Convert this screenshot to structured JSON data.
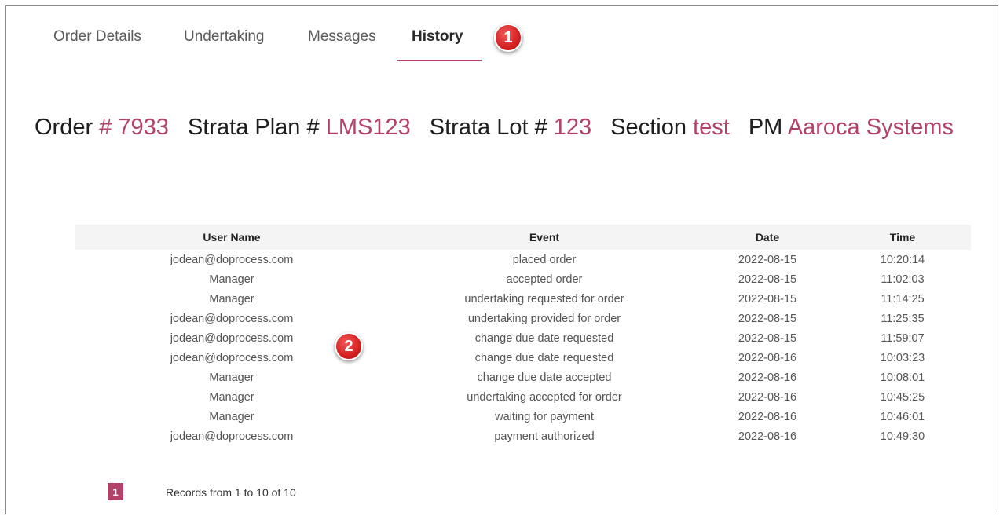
{
  "tabs": [
    {
      "label": "Order Details"
    },
    {
      "label": "Undertaking"
    },
    {
      "label": "Messages"
    },
    {
      "label": "History"
    }
  ],
  "active_tab": "History",
  "markers": [
    "1",
    "2"
  ],
  "order_info": {
    "order_label": "Order",
    "order_value": "# 7933",
    "plan_label": "Strata Plan #",
    "plan_value": "LMS123",
    "lot_label": "Strata Lot #",
    "lot_value": "123",
    "section_label": "Section",
    "section_value": "test",
    "pm_label": "PM",
    "pm_value": "Aaroca Systems"
  },
  "table": {
    "headers": [
      "User Name",
      "Event",
      "Date",
      "Time"
    ],
    "rows": [
      [
        "jodean@doprocess.com",
        "placed order",
        "2022-08-15",
        "10:20:14"
      ],
      [
        "Manager",
        "accepted order",
        "2022-08-15",
        "11:02:03"
      ],
      [
        "Manager",
        "undertaking requested for order",
        "2022-08-15",
        "11:14:25"
      ],
      [
        "jodean@doprocess.com",
        "undertaking provided for order",
        "2022-08-15",
        "11:25:35"
      ],
      [
        "jodean@doprocess.com",
        "change due date requested",
        "2022-08-15",
        "11:59:07"
      ],
      [
        "jodean@doprocess.com",
        "change due date requested",
        "2022-08-16",
        "10:03:23"
      ],
      [
        "Manager",
        "change due date accepted",
        "2022-08-16",
        "10:08:01"
      ],
      [
        "Manager",
        "undertaking accepted for order",
        "2022-08-16",
        "10:45:25"
      ],
      [
        "Manager",
        "waiting for payment",
        "2022-08-16",
        "10:46:01"
      ],
      [
        "jodean@doprocess.com",
        "payment authorized",
        "2022-08-16",
        "10:49:30"
      ]
    ]
  },
  "pagination": {
    "current_page": "1",
    "records_text": "Records from 1 to 10 of 10"
  },
  "colors": {
    "accent": "#b3426b",
    "marker": "#d52020"
  }
}
